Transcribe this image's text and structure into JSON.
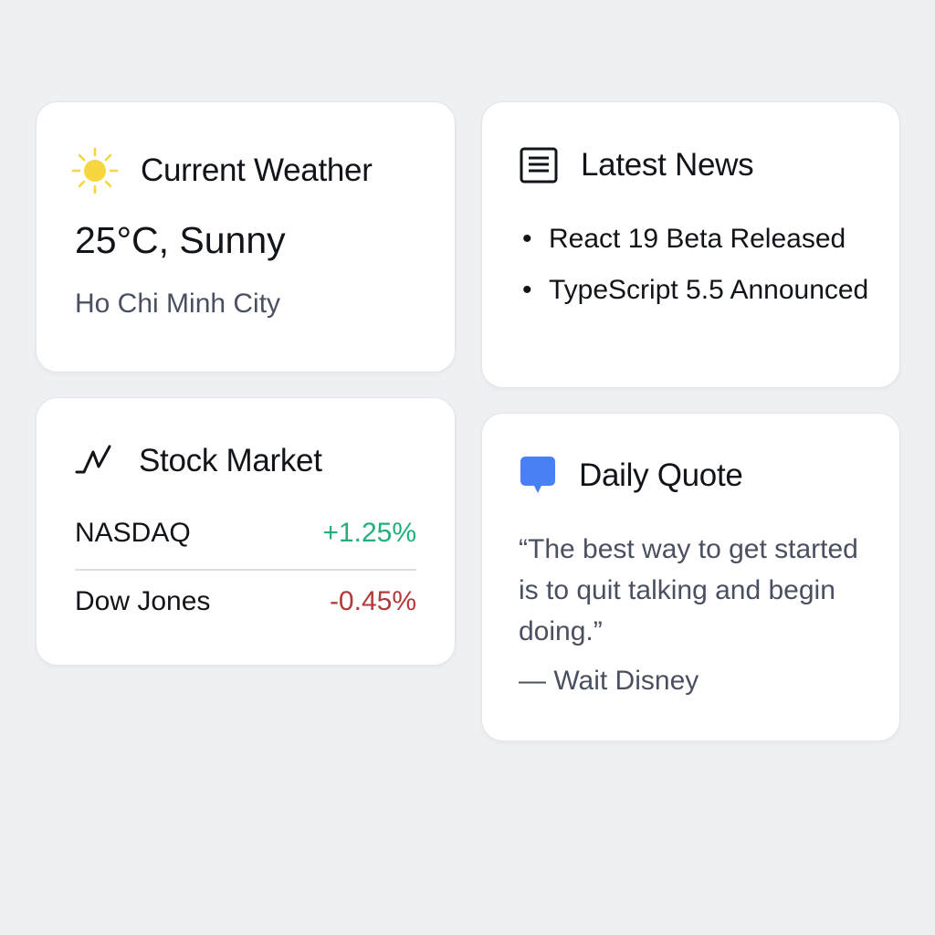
{
  "weather": {
    "title": "Current Weather",
    "icon": "sun-icon",
    "temperature": "25°C, Sunny",
    "city": "Ho Chi Minh City"
  },
  "news": {
    "title": "Latest News",
    "icon": "newspaper-icon",
    "items": [
      {
        "label": "React 19 Beta Released"
      },
      {
        "label": "TypeScript 5.5 Announced"
      }
    ]
  },
  "stocks": {
    "title": "Stock Market",
    "icon": "trend-line-icon",
    "rows": [
      {
        "name": "NASDAQ",
        "change": "+1.25%"
      },
      {
        "name": "Dow Jones",
        "change": "-0.45%"
      }
    ]
  },
  "quote": {
    "title": "Daily Quote",
    "icon": "speech-bubble-icon",
    "text": "“The best way to get started is to quit talking and begin doing.”",
    "author": "— Wait Disney"
  },
  "colors": {
    "background": "#eff0f3",
    "card": "#ffffff",
    "positive": "#22b07a",
    "negative": "#b23a3a",
    "accent": "#4a80f5",
    "sun": "#f7d640"
  }
}
